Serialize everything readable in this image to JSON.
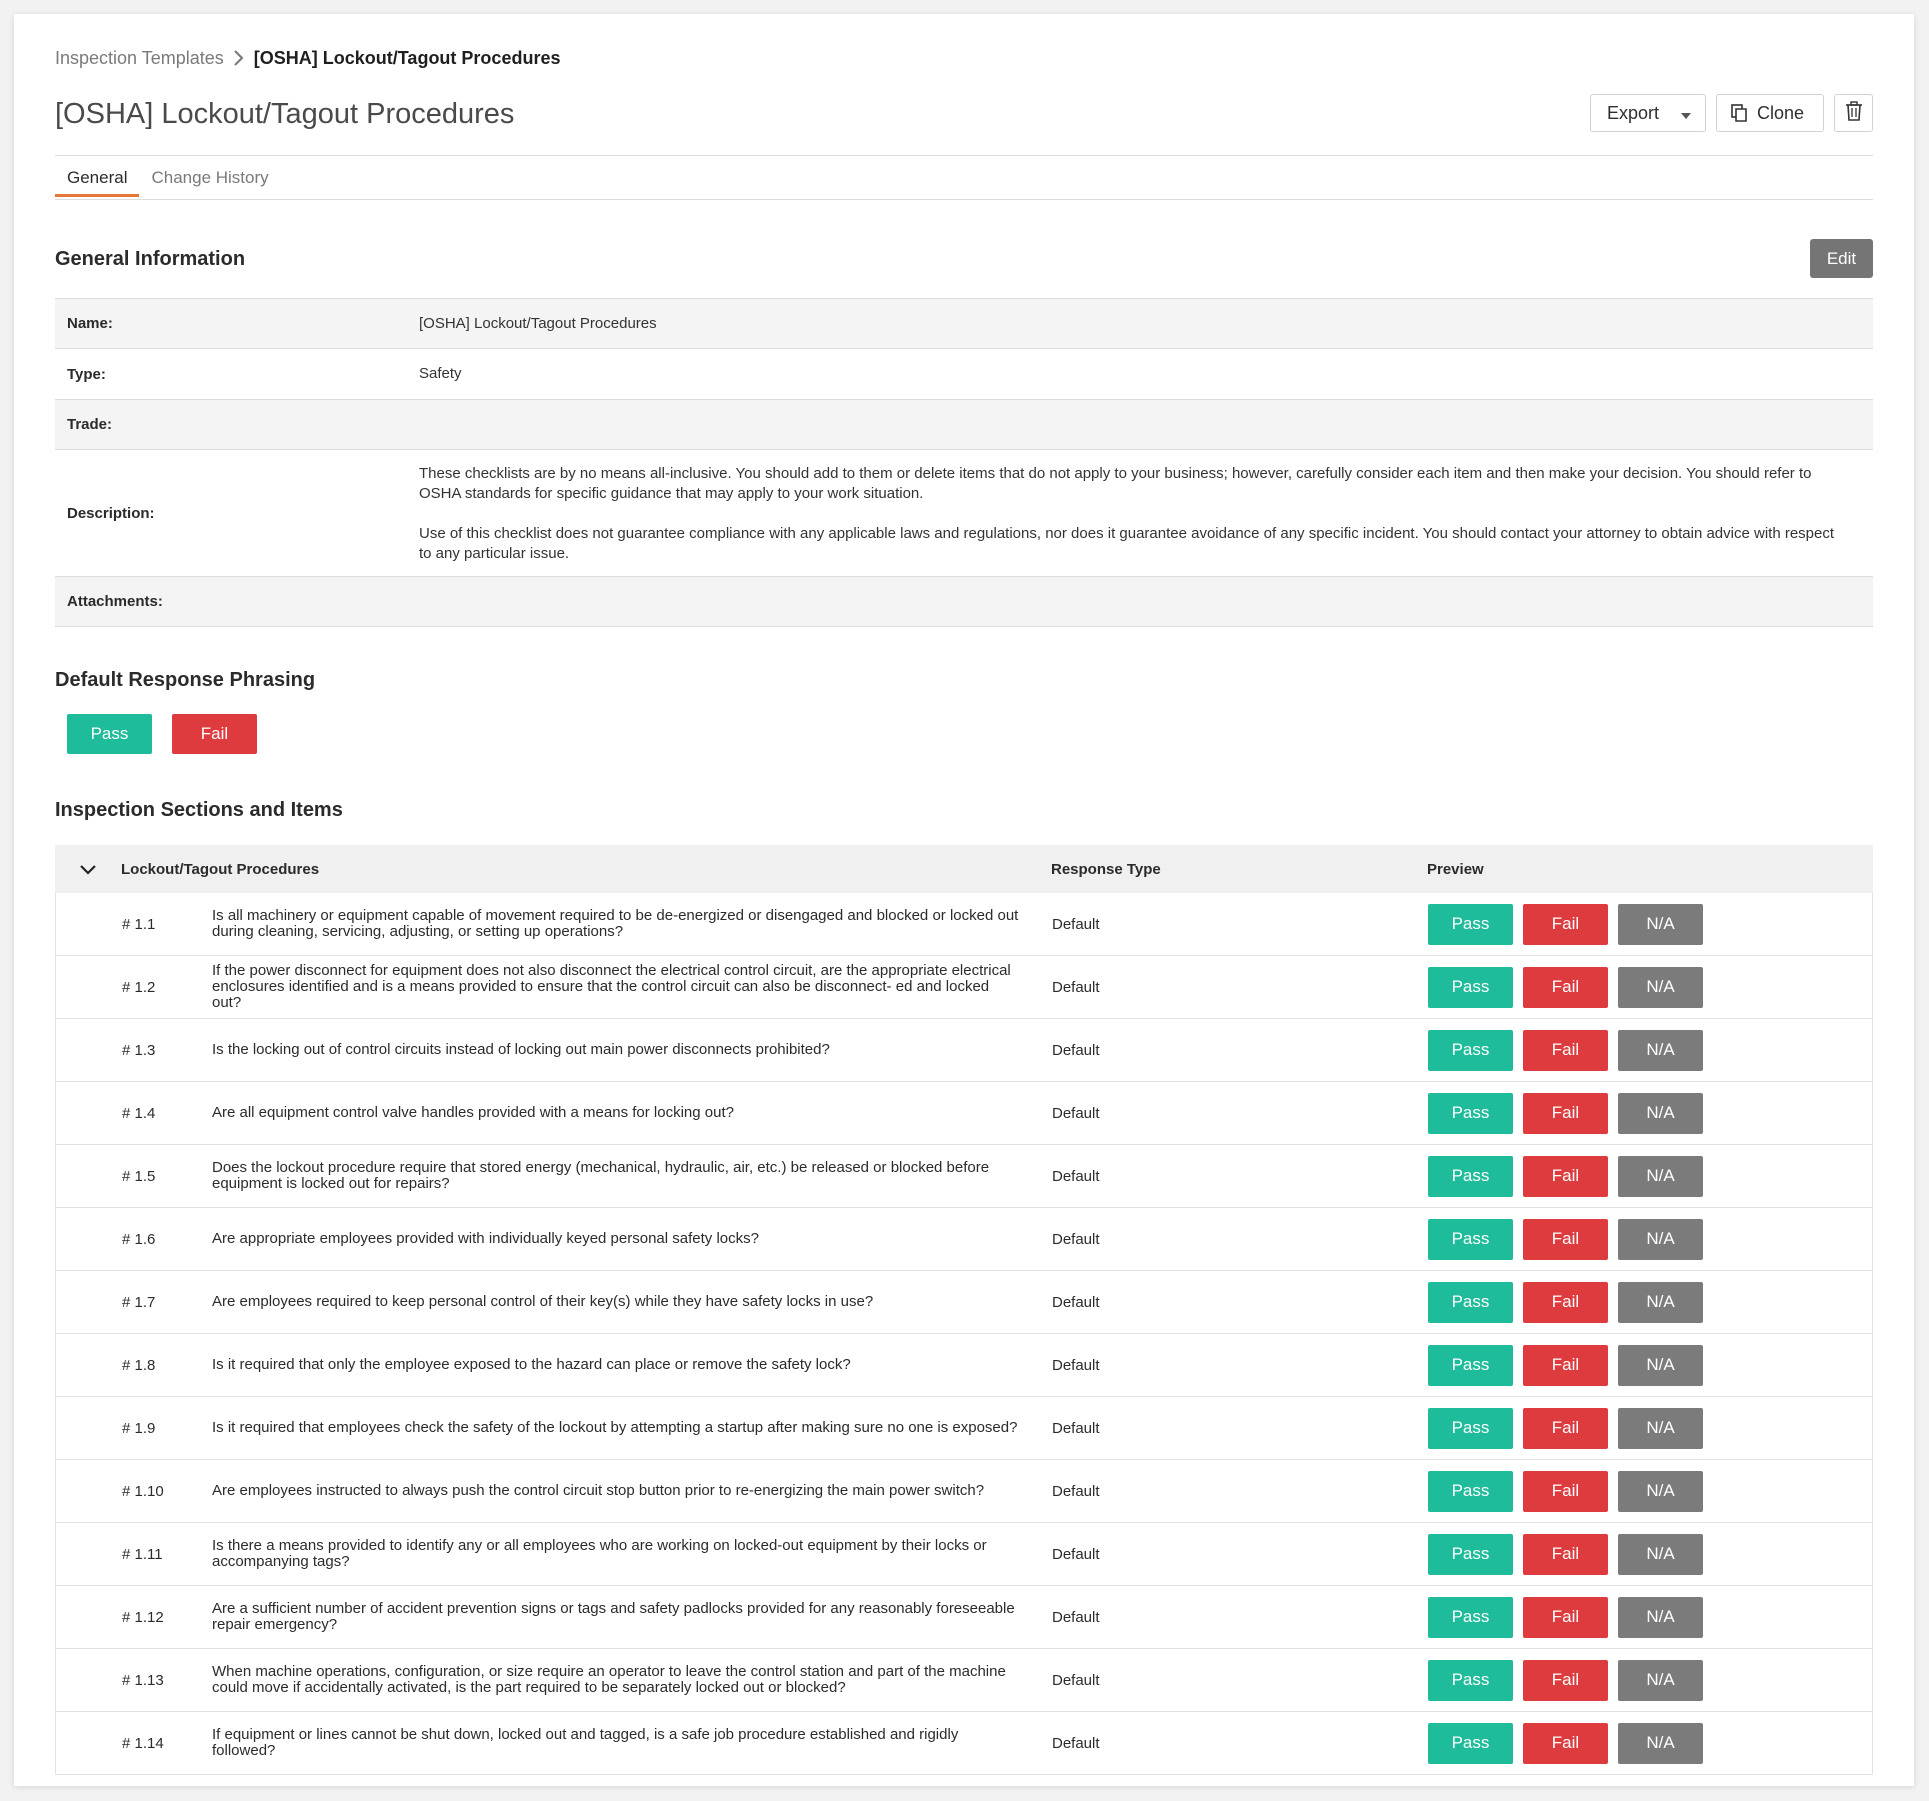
{
  "breadcrumb": {
    "parent": "Inspection Templates",
    "current": "[OSHA] Lockout/Tagout Procedures"
  },
  "page": {
    "title": "[OSHA] Lockout/Tagout Procedures"
  },
  "actions": {
    "export": "Export",
    "clone": "Clone"
  },
  "tabs": [
    {
      "label": "General"
    },
    {
      "label": "Change History"
    }
  ],
  "general_info": {
    "title": "General Information",
    "edit": "Edit",
    "rows": [
      {
        "label": "Name:",
        "value": "[OSHA] Lockout/Tagout Procedures"
      },
      {
        "label": "Type:",
        "value": "Safety"
      },
      {
        "label": "Trade:",
        "value": ""
      },
      {
        "label": "Description:",
        "value": ""
      },
      {
        "label": "Attachments:",
        "value": ""
      }
    ],
    "description": [
      "These checklists are by no means all-inclusive. You should add to them or delete items that do not apply to your business; however, carefully consider each item and then make your decision. You should refer to OSHA standards for specific guidance that may apply to your work situation.",
      "Use of this checklist does not guarantee compliance with any applicable laws and regulations, nor does it guarantee avoidance of any specific incident. You should contact your attorney to obtain advice with respect to any particular issue."
    ]
  },
  "phrasing": {
    "title": "Default Response Phrasing",
    "pass": "Pass",
    "fail": "Fail"
  },
  "sections": {
    "title": "Inspection Sections and Items",
    "section_name": "Lockout/Tagout Procedures",
    "col_response": "Response Type",
    "col_preview": "Preview",
    "preview_labels": {
      "pass": "Pass",
      "fail": "Fail",
      "na": "N/A"
    },
    "items": [
      {
        "num": "# 1.1",
        "q": "Is all machinery or equipment capable of movement required to be de-energized or disengaged and blocked or locked out during cleaning, servicing, adjusting, or setting up operations?",
        "type": "Default"
      },
      {
        "num": "# 1.2",
        "q": "If the power disconnect for equipment does not also disconnect the electrical control circuit, are the appropriate electrical enclosures identified and is a means provided to ensure that the control circuit can also be disconnect- ed and locked out?",
        "type": "Default"
      },
      {
        "num": "# 1.3",
        "q": "Is the locking out of control circuits instead of locking out main power disconnects prohibited?",
        "type": "Default"
      },
      {
        "num": "# 1.4",
        "q": "Are all equipment control valve handles provided with a means for locking out?",
        "type": "Default"
      },
      {
        "num": "# 1.5",
        "q": "Does the lockout procedure require that stored energy (mechanical, hydraulic, air, etc.) be released or blocked before equipment is locked out for repairs?",
        "type": "Default"
      },
      {
        "num": "# 1.6",
        "q": "Are appropriate employees provided with individually keyed personal safety locks?",
        "type": "Default"
      },
      {
        "num": "# 1.7",
        "q": "Are employees required to keep personal control of their key(s) while they have safety locks in use?",
        "type": "Default"
      },
      {
        "num": "# 1.8",
        "q": "Is it required that only the employee exposed to the hazard can place or remove the safety lock?",
        "type": "Default"
      },
      {
        "num": "# 1.9",
        "q": "Is it required that employees check the safety of the lockout by attempting a startup after making sure no one is exposed?",
        "type": "Default"
      },
      {
        "num": "# 1.10",
        "q": "Are employees instructed to always push the control circuit stop button prior to re-energizing the main power switch?",
        "type": "Default"
      },
      {
        "num": "# 1.11",
        "q": "Is there a means provided to identify any or all employees who are working on locked-out equipment by their locks or accompanying tags?",
        "type": "Default"
      },
      {
        "num": "# 1.12",
        "q": "Are a sufficient number of accident prevention signs or tags and safety padlocks provided for any reasonably foreseeable repair emergency?",
        "type": "Default"
      },
      {
        "num": "# 1.13",
        "q": "When machine operations, configuration, or size require an operator to leave the control station and part of the machine could move if accidentally activated, is the part required to be separately locked out or blocked?",
        "type": "Default"
      },
      {
        "num": "# 1.14",
        "q": "If equipment or lines cannot be shut down, locked out and tagged, is a safe job procedure established and rigidly followed?",
        "type": "Default"
      }
    ]
  },
  "colors": {
    "pass": "#1ebc9b",
    "fail": "#de3b3f",
    "na": "#7b7b7b",
    "tab_accent": "#e8773a",
    "edit_button": "#757575"
  },
  "icons": {
    "breadcrumb_sep": "chevron-right-icon",
    "export_caret": "caret-down-icon",
    "clone": "copy-icon",
    "delete": "trash-icon",
    "collapse": "chevron-down-icon"
  }
}
